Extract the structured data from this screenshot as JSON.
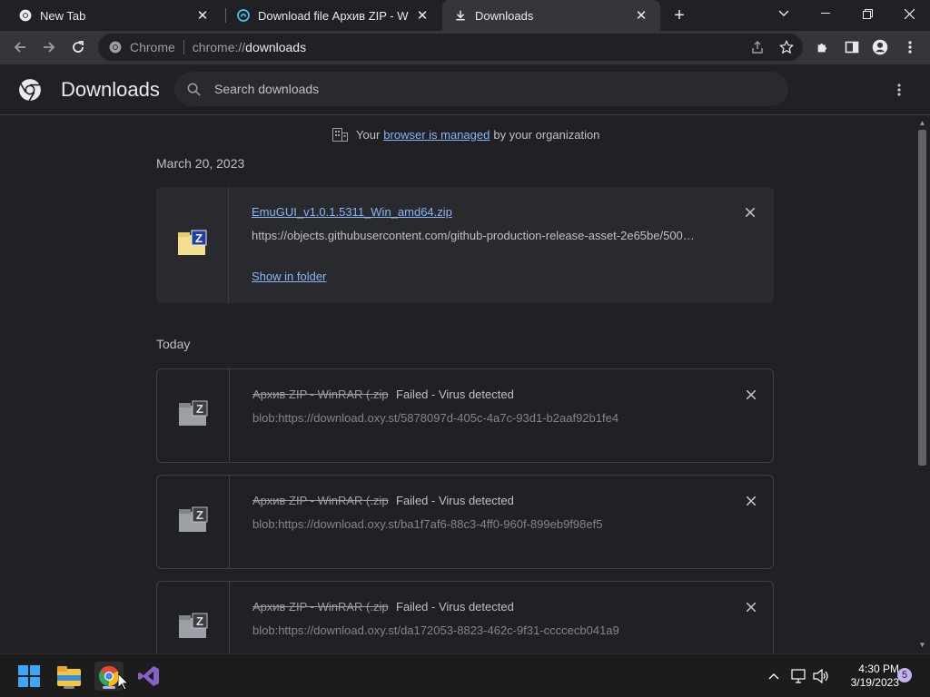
{
  "tabs": [
    {
      "title": "New Tab",
      "icon": "chrome-icon"
    },
    {
      "title": "Download file Архив ZIP - WinRAR",
      "icon": "download-site-icon"
    },
    {
      "title": "Downloads",
      "icon": "download-icon",
      "active": true
    }
  ],
  "omnibox": {
    "host": "Chrome",
    "scheme": "chrome://",
    "path": "downloads"
  },
  "header": {
    "title": "Downloads",
    "search_placeholder": "Search downloads"
  },
  "managed": {
    "prefix": "Your",
    "link": "browser is managed",
    "suffix": "by your organization"
  },
  "groups": [
    {
      "date": "March 20, 2023",
      "items": [
        {
          "filename": "EmuGUI_v1.0.1.5311_Win_amd64.zip",
          "url": "https://objects.githubusercontent.com/github-production-release-asset-2e65be/500…",
          "action": "Show in folder",
          "status": ""
        }
      ]
    },
    {
      "date": "Today",
      "items": [
        {
          "filename": "Архив ZIP - WinRAR (.zip",
          "status": "Failed - Virus detected",
          "url": "blob:https://download.oxy.st/5878097d-405c-4a7c-93d1-b2aaf92b1fe4"
        },
        {
          "filename": "Архив ZIP - WinRAR (.zip",
          "status": "Failed - Virus detected",
          "url": "blob:https://download.oxy.st/ba1f7af6-88c3-4ff0-960f-899eb9f98ef5"
        },
        {
          "filename": "Архив ZIP - WinRAR (.zip",
          "status": "Failed - Virus detected",
          "url": "blob:https://download.oxy.st/da172053-8823-462c-9f31-ccccecb041a9"
        }
      ]
    }
  ],
  "taskbar": {
    "time": "4:30 PM",
    "date": "3/19/2023",
    "notifications": "5"
  },
  "colors": {
    "accent_link": "#8ab4f8",
    "background": "#202124",
    "toolbar": "#35363a"
  }
}
